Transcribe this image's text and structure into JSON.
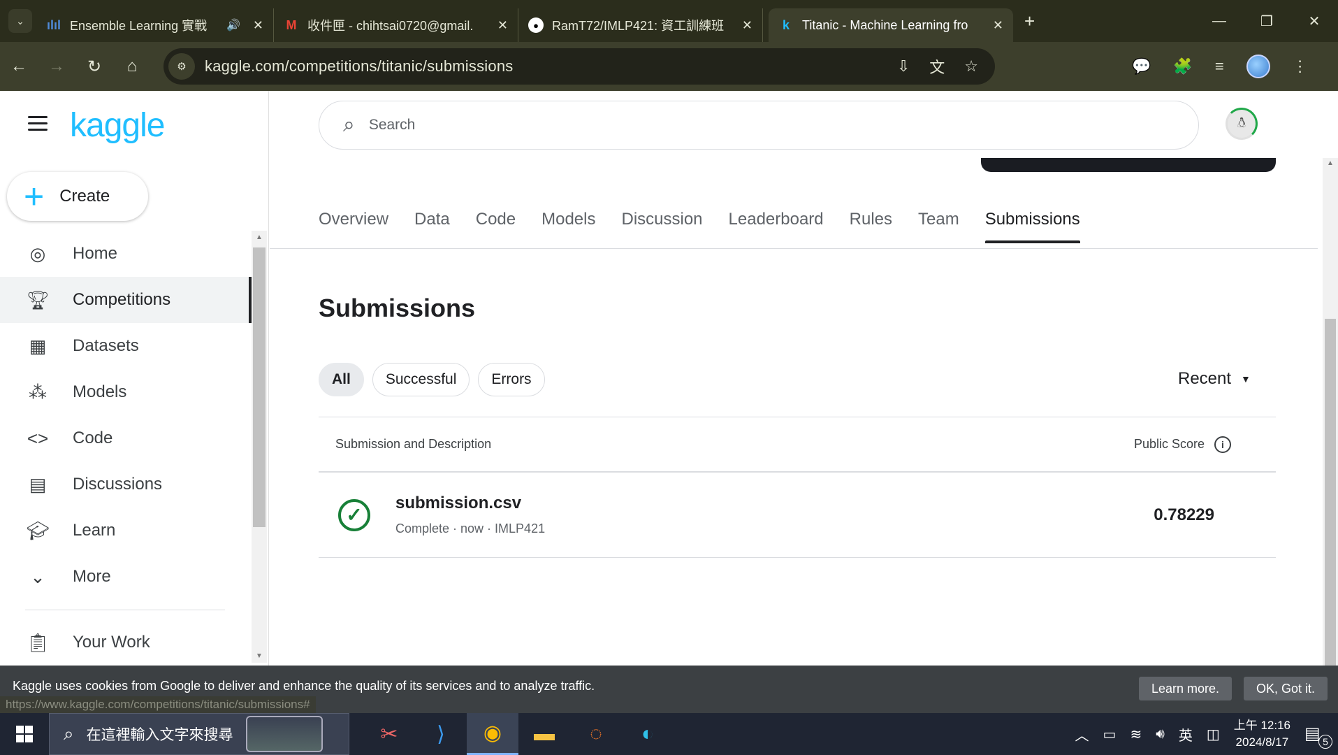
{
  "browser": {
    "tabs": [
      {
        "title": "Ensemble Learning 實戰",
        "icon": "chart-bar-icon",
        "audio": true
      },
      {
        "title": "收件匣 - chihtsai0720@gmail.",
        "icon": "gmail-icon"
      },
      {
        "title": "RamT72/IMLP421: 資工訓練班",
        "icon": "github-icon"
      },
      {
        "title": "Titanic - Machine Learning fro",
        "icon": "kaggle-k-icon",
        "active": true
      }
    ],
    "new_tab": "+",
    "url": "kaggle.com/competitions/titanic/submissions",
    "status_url": "https://www.kaggle.com/competitions/titanic/submissions#"
  },
  "sidebar": {
    "logo": "kaggle",
    "create_label": "Create",
    "items": [
      {
        "label": "Home",
        "icon": "compass-icon"
      },
      {
        "label": "Competitions",
        "icon": "trophy-icon",
        "selected": true
      },
      {
        "label": "Datasets",
        "icon": "table-icon"
      },
      {
        "label": "Models",
        "icon": "models-icon"
      },
      {
        "label": "Code",
        "icon": "code-icon"
      },
      {
        "label": "Discussions",
        "icon": "comment-icon"
      },
      {
        "label": "Learn",
        "icon": "school-icon"
      },
      {
        "label": "More",
        "icon": "chevron-down-icon"
      }
    ],
    "your_work": "Your Work"
  },
  "search": {
    "placeholder": "Search"
  },
  "competition_tabs": [
    "Overview",
    "Data",
    "Code",
    "Models",
    "Discussion",
    "Leaderboard",
    "Rules",
    "Team",
    "Submissions"
  ],
  "active_tab": "Submissions",
  "page_title": "Submissions",
  "filters": {
    "all": "All",
    "successful": "Successful",
    "errors": "Errors",
    "sort": "Recent"
  },
  "table": {
    "col_submission": "Submission and Description",
    "col_score": "Public Score",
    "rows": [
      {
        "file": "submission.csv",
        "meta": "Complete · now · IMLP421",
        "score": "0.78229"
      }
    ]
  },
  "cookie": {
    "text": "Kaggle uses cookies from Google to deliver and enhance the quality of its services and to analyze traffic.",
    "learn_more": "Learn more.",
    "ok": "OK, Got it."
  },
  "taskbar": {
    "search_placeholder": "在這裡輸入文字來搜尋",
    "ime": "英",
    "time": "上午 12:16",
    "date": "2024/8/17",
    "notifications": "5"
  }
}
